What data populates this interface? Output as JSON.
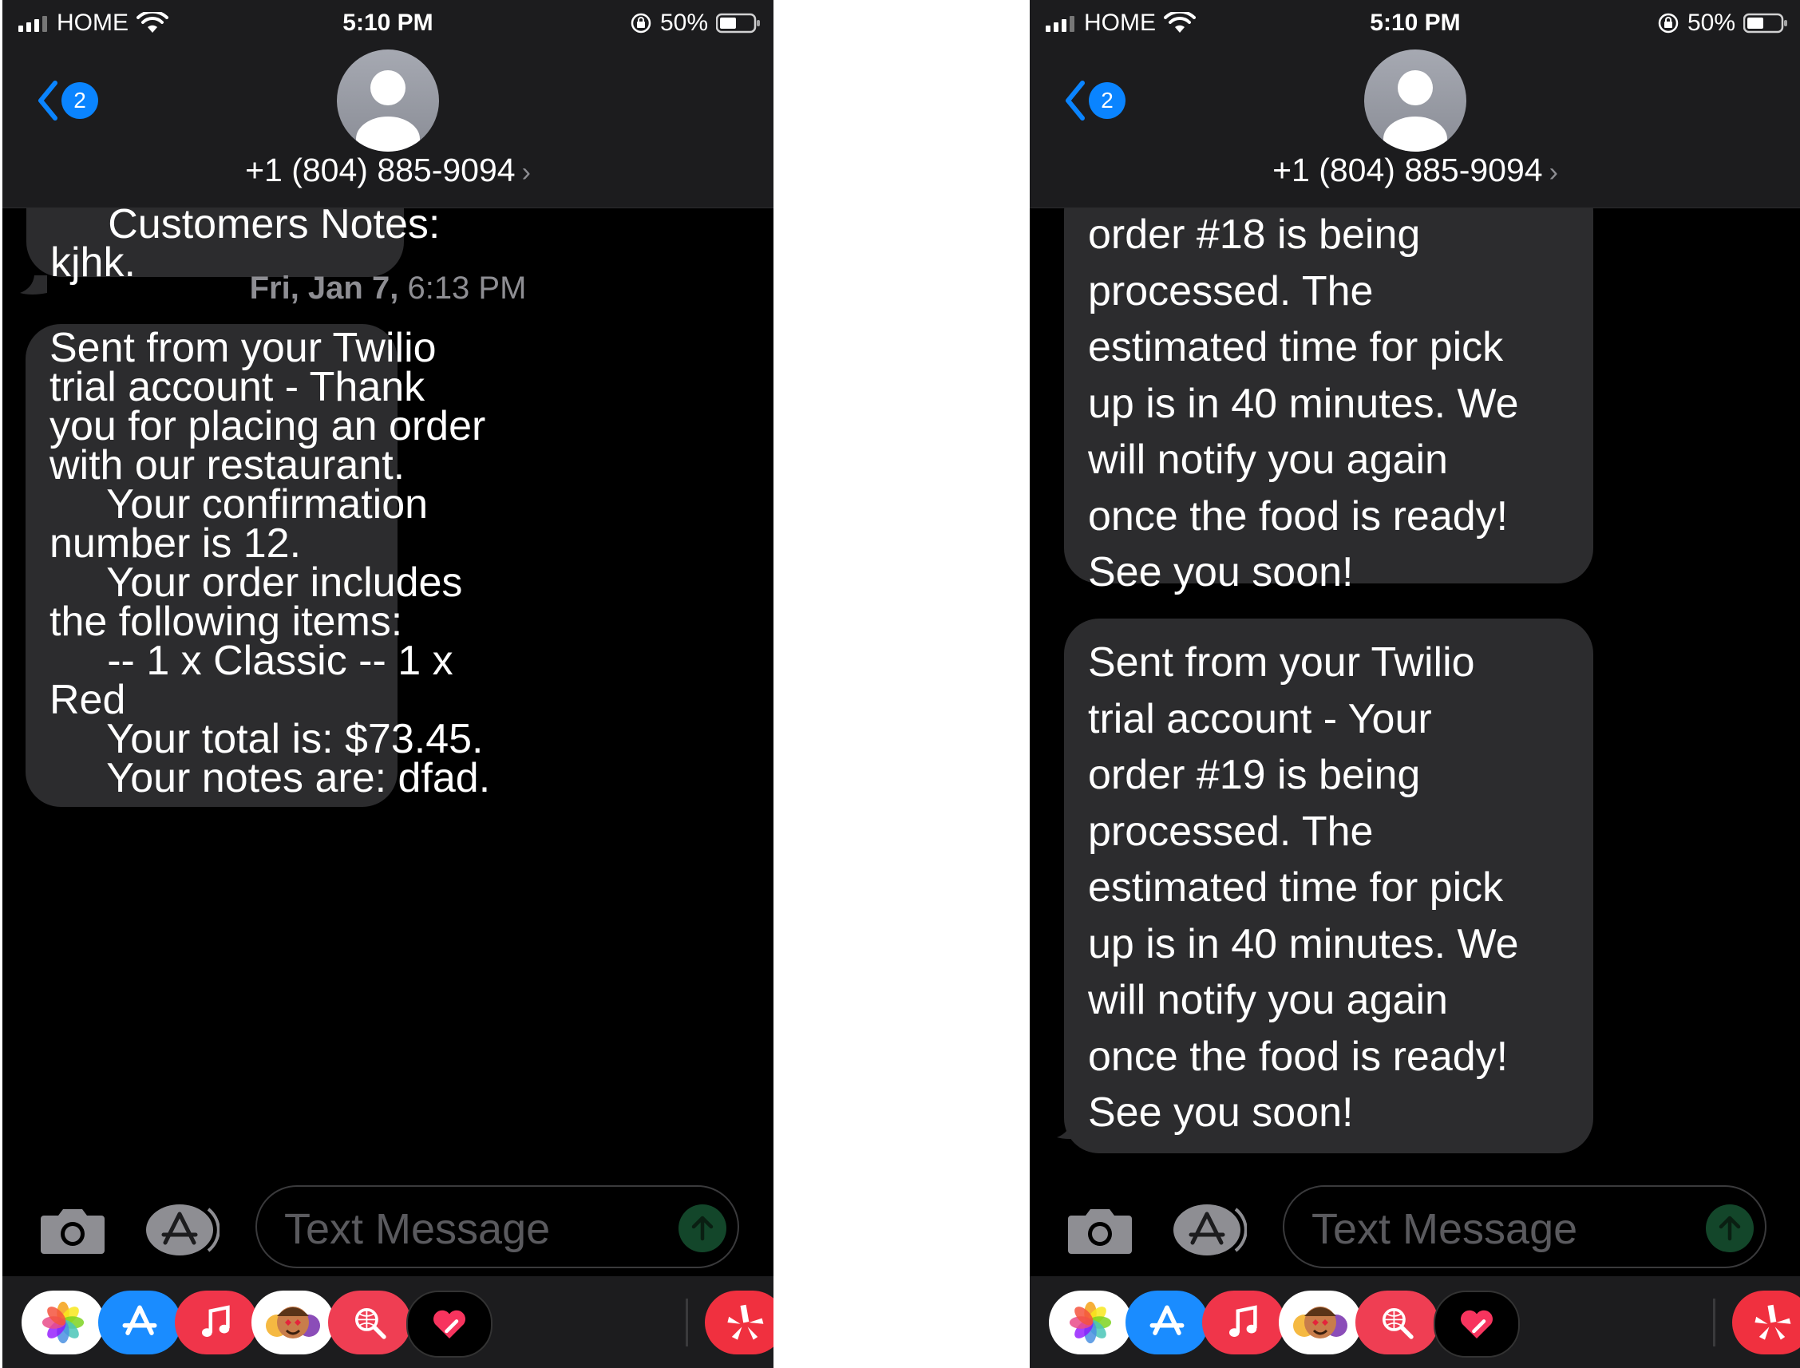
{
  "screens": [
    {
      "status": {
        "carrier": "HOME",
        "time": "5:10 PM",
        "battery": "50%"
      },
      "nav": {
        "back_count": "2",
        "contact": "+1 (804) 885-9094",
        "chevron": "›"
      },
      "top_bubble_lines": [
        "     Customers Notes:",
        "kjhk."
      ],
      "timestamp": {
        "day": "Fri, Jan 7,",
        "time": "6:13 PM"
      },
      "main_bubble_lines": [
        "Sent from your Twilio",
        "trial account - Thank",
        "you for placing an order",
        "with our restaurant.",
        "     Your confirmation",
        "number is 12.",
        "     Your order includes",
        "the following items:",
        "     -- 1 x Classic -- 1 x",
        "Red",
        "     Your total is: $73.45.",
        "     Your notes are: dfad."
      ],
      "input": {
        "placeholder": "Text Message"
      }
    },
    {
      "status": {
        "carrier": "HOME",
        "time": "5:10 PM",
        "battery": "50%"
      },
      "nav": {
        "back_count": "2",
        "contact": "+1 (804) 885-9094",
        "chevron": "›"
      },
      "bubble1_lines": [
        "order #18 is being",
        "processed. The",
        "estimated time for pick",
        "up is in 40 minutes. We",
        "will notify you again",
        "once the food is ready!",
        "See you soon!"
      ],
      "bubble2_lines": [
        "Sent from your Twilio",
        "trial account - Your",
        "order #19 is being",
        "processed. The",
        "estimated time for pick",
        "up is in 40 minutes. We",
        "will notify you again",
        "once the food is ready!",
        "See you soon!"
      ],
      "input": {
        "placeholder": "Text Message"
      }
    }
  ],
  "tray_icons": [
    "photos-icon",
    "app-store-icon",
    "music-icon",
    "memoji-icon",
    "web-search-icon",
    "digital-touch-icon",
    "yelp-icon"
  ],
  "colors": {
    "bubble": "#2c2c2e",
    "accent": "#0a84ff",
    "send": "#13462a",
    "background": "#000000"
  }
}
